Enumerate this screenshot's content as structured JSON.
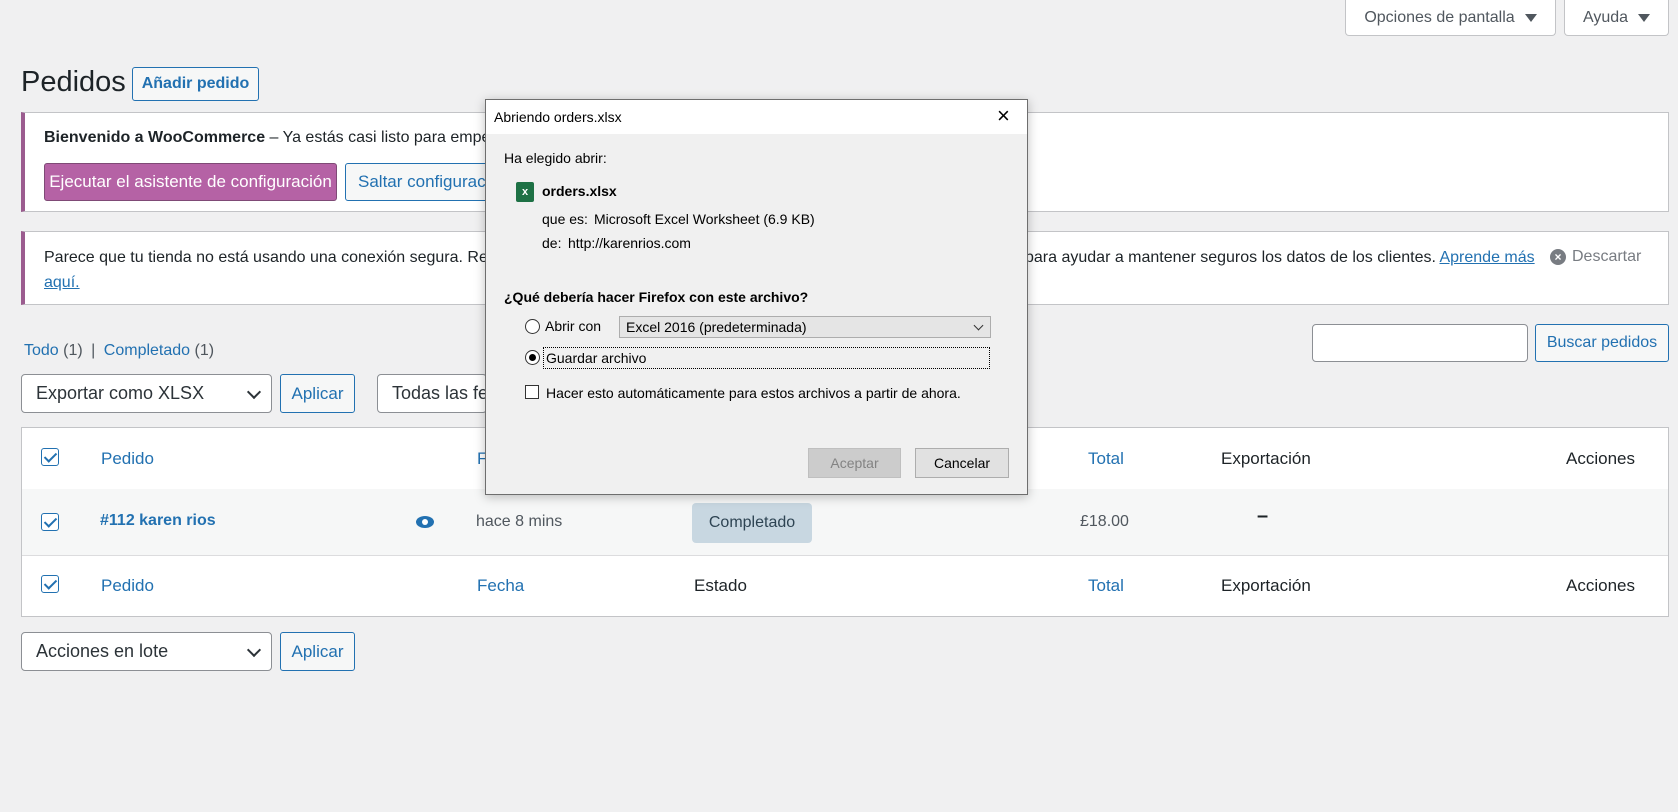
{
  "top_bar": {
    "screen_options": "Opciones de pantalla",
    "help": "Ayuda"
  },
  "header": {
    "title": "Pedidos",
    "add_order": "Añadir pedido"
  },
  "welcome_notice": {
    "strong": "Bienvenido a WooCommerce",
    "text": " – Ya estás casi listo para empez",
    "run_wizard": "Ejecutar el asistente de configuración",
    "skip": "Saltar configuració"
  },
  "security_notice": {
    "text_left": "Parece que tu tienda no está usando una conexión segura. Rec",
    "text_right": "para ayudar a mantener seguros los datos de los clientes.",
    "learn_more_1": "Aprende más",
    "learn_more_2": "aquí.",
    "dismiss": "Descartar"
  },
  "filters": {
    "all": "Todo",
    "all_count": "(1)",
    "separator": "|",
    "completed": "Completado",
    "completed_count": "(1)",
    "export_select": "Exportar como XLSX",
    "apply": "Aplicar",
    "dates_select": "Todas las fec",
    "search_button": "Buscar pedidos",
    "search_value": ""
  },
  "table": {
    "headers": {
      "order": "Pedido",
      "date_partial": "F",
      "total": "Total",
      "export": "Exportación",
      "actions": "Acciones"
    },
    "footer_headers": {
      "order": "Pedido",
      "date": "Fecha",
      "status": "Estado",
      "total": "Total",
      "export": "Exportación",
      "actions": "Acciones"
    },
    "rows": [
      {
        "order": "#112 karen rios",
        "date": "hace 8 mins",
        "status": "Completado",
        "total": "£18.00",
        "export": "–"
      }
    ]
  },
  "bulk": {
    "select": "Acciones en lote",
    "apply": "Aplicar"
  },
  "dialog": {
    "title": "Abriendo orders.xlsx",
    "chosen": "Ha elegido abrir:",
    "filename": "orders.xlsx",
    "type_label": "que es:",
    "type_value": "Microsoft Excel Worksheet (6.9 KB)",
    "from_label": "de:",
    "from_value": "http://karenrios.com",
    "question": "¿Qué debería hacer Firefox con este archivo?",
    "open_with": "Abrir con",
    "open_with_app": "Excel 2016 (predeterminada)",
    "save_file": "Guardar archivo",
    "auto": "Hacer esto automáticamente para estos archivos a partir de ahora.",
    "ok": "Aceptar",
    "cancel": "Cancelar",
    "selected_option": "save_file",
    "auto_checked": false
  },
  "colors": {
    "link": "#2271b1",
    "woo_purple": "#b562a5",
    "status_completed_bg": "#c8d7e1"
  }
}
